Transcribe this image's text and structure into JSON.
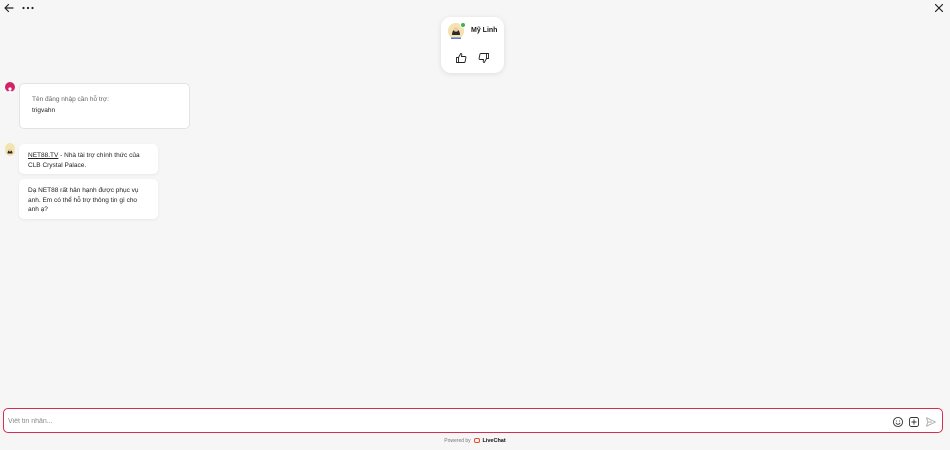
{
  "header": {
    "back_icon": "arrow-left-icon",
    "more_icon": "more-horizontal-icon",
    "close_icon": "close-icon"
  },
  "agent": {
    "name": "Mỹ Linh",
    "status_color": "#3bb54a",
    "rate_good_icon": "thumbs-up-icon",
    "rate_bad_icon": "thumbs-down-icon"
  },
  "visitor_form": {
    "label": "Tên đăng nhập cần hỗ trợ:",
    "value": "trigvahn",
    "avatar_color": "#d12366"
  },
  "messages": [
    {
      "link": "NET88.TV",
      "text": " - Nhà tài trợ chính thức của CLB Crystal Palace."
    },
    {
      "text": "Dạ NET88 rất hân hạnh được phục vụ anh. Em có thể hỗ trợ thông tin gì cho anh ạ?"
    }
  ],
  "composer": {
    "placeholder": "Viết tin nhắn...",
    "value": "",
    "border_color": "#d12f54",
    "emoji_icon": "smiley-icon",
    "attach_icon": "attachment-plus-icon",
    "send_icon": "send-icon"
  },
  "footer": {
    "powered_by": "Powered by",
    "brand": "LiveChat",
    "brand_color": "#e24b2e"
  }
}
